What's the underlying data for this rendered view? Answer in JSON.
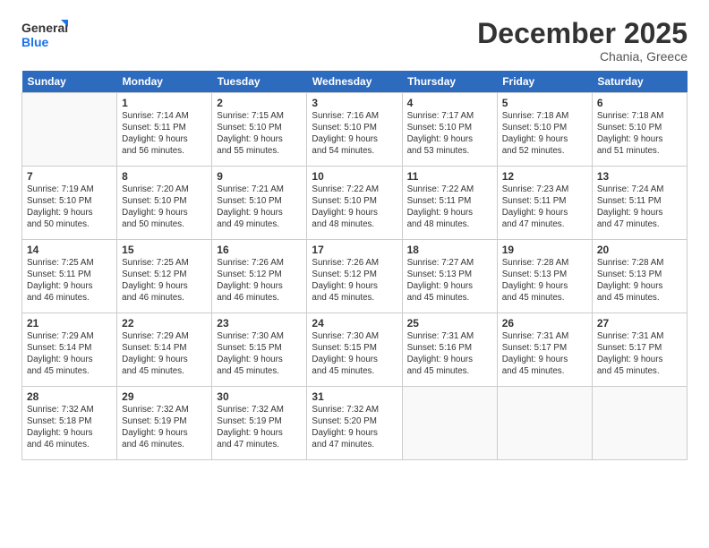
{
  "logo": {
    "line1": "General",
    "line2": "Blue"
  },
  "title": "December 2025",
  "location": "Chania, Greece",
  "days": [
    "Sunday",
    "Monday",
    "Tuesday",
    "Wednesday",
    "Thursday",
    "Friday",
    "Saturday"
  ],
  "weeks": [
    [
      {
        "date": "",
        "info": ""
      },
      {
        "date": "1",
        "info": "Sunrise: 7:14 AM\nSunset: 5:11 PM\nDaylight: 9 hours\nand 56 minutes."
      },
      {
        "date": "2",
        "info": "Sunrise: 7:15 AM\nSunset: 5:10 PM\nDaylight: 9 hours\nand 55 minutes."
      },
      {
        "date": "3",
        "info": "Sunrise: 7:16 AM\nSunset: 5:10 PM\nDaylight: 9 hours\nand 54 minutes."
      },
      {
        "date": "4",
        "info": "Sunrise: 7:17 AM\nSunset: 5:10 PM\nDaylight: 9 hours\nand 53 minutes."
      },
      {
        "date": "5",
        "info": "Sunrise: 7:18 AM\nSunset: 5:10 PM\nDaylight: 9 hours\nand 52 minutes."
      },
      {
        "date": "6",
        "info": "Sunrise: 7:18 AM\nSunset: 5:10 PM\nDaylight: 9 hours\nand 51 minutes."
      }
    ],
    [
      {
        "date": "7",
        "info": "Sunrise: 7:19 AM\nSunset: 5:10 PM\nDaylight: 9 hours\nand 50 minutes."
      },
      {
        "date": "8",
        "info": "Sunrise: 7:20 AM\nSunset: 5:10 PM\nDaylight: 9 hours\nand 50 minutes."
      },
      {
        "date": "9",
        "info": "Sunrise: 7:21 AM\nSunset: 5:10 PM\nDaylight: 9 hours\nand 49 minutes."
      },
      {
        "date": "10",
        "info": "Sunrise: 7:22 AM\nSunset: 5:10 PM\nDaylight: 9 hours\nand 48 minutes."
      },
      {
        "date": "11",
        "info": "Sunrise: 7:22 AM\nSunset: 5:11 PM\nDaylight: 9 hours\nand 48 minutes."
      },
      {
        "date": "12",
        "info": "Sunrise: 7:23 AM\nSunset: 5:11 PM\nDaylight: 9 hours\nand 47 minutes."
      },
      {
        "date": "13",
        "info": "Sunrise: 7:24 AM\nSunset: 5:11 PM\nDaylight: 9 hours\nand 47 minutes."
      }
    ],
    [
      {
        "date": "14",
        "info": "Sunrise: 7:25 AM\nSunset: 5:11 PM\nDaylight: 9 hours\nand 46 minutes."
      },
      {
        "date": "15",
        "info": "Sunrise: 7:25 AM\nSunset: 5:12 PM\nDaylight: 9 hours\nand 46 minutes."
      },
      {
        "date": "16",
        "info": "Sunrise: 7:26 AM\nSunset: 5:12 PM\nDaylight: 9 hours\nand 46 minutes."
      },
      {
        "date": "17",
        "info": "Sunrise: 7:26 AM\nSunset: 5:12 PM\nDaylight: 9 hours\nand 45 minutes."
      },
      {
        "date": "18",
        "info": "Sunrise: 7:27 AM\nSunset: 5:13 PM\nDaylight: 9 hours\nand 45 minutes."
      },
      {
        "date": "19",
        "info": "Sunrise: 7:28 AM\nSunset: 5:13 PM\nDaylight: 9 hours\nand 45 minutes."
      },
      {
        "date": "20",
        "info": "Sunrise: 7:28 AM\nSunset: 5:13 PM\nDaylight: 9 hours\nand 45 minutes."
      }
    ],
    [
      {
        "date": "21",
        "info": "Sunrise: 7:29 AM\nSunset: 5:14 PM\nDaylight: 9 hours\nand 45 minutes."
      },
      {
        "date": "22",
        "info": "Sunrise: 7:29 AM\nSunset: 5:14 PM\nDaylight: 9 hours\nand 45 minutes."
      },
      {
        "date": "23",
        "info": "Sunrise: 7:30 AM\nSunset: 5:15 PM\nDaylight: 9 hours\nand 45 minutes."
      },
      {
        "date": "24",
        "info": "Sunrise: 7:30 AM\nSunset: 5:15 PM\nDaylight: 9 hours\nand 45 minutes."
      },
      {
        "date": "25",
        "info": "Sunrise: 7:31 AM\nSunset: 5:16 PM\nDaylight: 9 hours\nand 45 minutes."
      },
      {
        "date": "26",
        "info": "Sunrise: 7:31 AM\nSunset: 5:17 PM\nDaylight: 9 hours\nand 45 minutes."
      },
      {
        "date": "27",
        "info": "Sunrise: 7:31 AM\nSunset: 5:17 PM\nDaylight: 9 hours\nand 45 minutes."
      }
    ],
    [
      {
        "date": "28",
        "info": "Sunrise: 7:32 AM\nSunset: 5:18 PM\nDaylight: 9 hours\nand 46 minutes."
      },
      {
        "date": "29",
        "info": "Sunrise: 7:32 AM\nSunset: 5:19 PM\nDaylight: 9 hours\nand 46 minutes."
      },
      {
        "date": "30",
        "info": "Sunrise: 7:32 AM\nSunset: 5:19 PM\nDaylight: 9 hours\nand 47 minutes."
      },
      {
        "date": "31",
        "info": "Sunrise: 7:32 AM\nSunset: 5:20 PM\nDaylight: 9 hours\nand 47 minutes."
      },
      {
        "date": "",
        "info": ""
      },
      {
        "date": "",
        "info": ""
      },
      {
        "date": "",
        "info": ""
      }
    ]
  ]
}
